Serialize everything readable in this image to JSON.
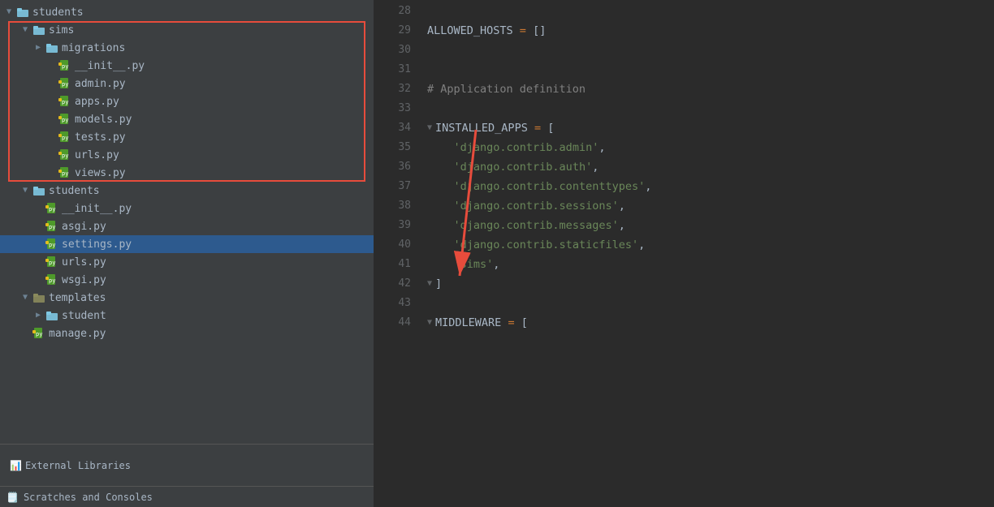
{
  "sidebar": {
    "items": [
      {
        "id": "students-root",
        "label": "students",
        "type": "folder",
        "indent": 0,
        "state": "open"
      },
      {
        "id": "sims-folder",
        "label": "sims",
        "type": "folder",
        "indent": 1,
        "state": "open",
        "redbox": true
      },
      {
        "id": "migrations-folder",
        "label": "migrations",
        "type": "folder",
        "indent": 2,
        "state": "closed"
      },
      {
        "id": "init-py-sims",
        "label": "__init__.py",
        "type": "file-py",
        "indent": 3
      },
      {
        "id": "admin-py",
        "label": "admin.py",
        "type": "file-py",
        "indent": 3
      },
      {
        "id": "apps-py",
        "label": "apps.py",
        "type": "file-py",
        "indent": 3
      },
      {
        "id": "models-py",
        "label": "models.py",
        "type": "file-py",
        "indent": 3
      },
      {
        "id": "tests-py",
        "label": "tests.py",
        "type": "file-py",
        "indent": 3
      },
      {
        "id": "urls-py-sims",
        "label": "urls.py",
        "type": "file-py",
        "indent": 3
      },
      {
        "id": "views-py",
        "label": "views.py",
        "type": "file-py",
        "indent": 3
      },
      {
        "id": "students-folder",
        "label": "students",
        "type": "folder",
        "indent": 1,
        "state": "open"
      },
      {
        "id": "init-py-students",
        "label": "__init__.py",
        "type": "file-py",
        "indent": 2
      },
      {
        "id": "asgi-py",
        "label": "asgi.py",
        "type": "file-py",
        "indent": 2
      },
      {
        "id": "settings-py",
        "label": "settings.py",
        "type": "file-py",
        "indent": 2,
        "selected": true
      },
      {
        "id": "urls-py-students",
        "label": "urls.py",
        "type": "file-py",
        "indent": 2
      },
      {
        "id": "wsgi-py",
        "label": "wsgi.py",
        "type": "file-py",
        "indent": 2
      },
      {
        "id": "templates-folder",
        "label": "templates",
        "type": "folder",
        "indent": 1,
        "state": "open"
      },
      {
        "id": "student-folder",
        "label": "student",
        "type": "folder",
        "indent": 2,
        "state": "closed"
      },
      {
        "id": "manage-py",
        "label": "manage.py",
        "type": "file-py",
        "indent": 1
      }
    ],
    "bottom": [
      {
        "id": "ext-libraries",
        "label": "External Libraries",
        "type": "folder-special"
      },
      {
        "id": "scratches",
        "label": "Scratches and Consoles",
        "type": "folder-special"
      }
    ]
  },
  "editor": {
    "lines": [
      {
        "num": 28,
        "content": "",
        "tokens": []
      },
      {
        "num": 29,
        "content": "ALLOWED_HOSTS = []",
        "tokens": [
          {
            "text": "ALLOWED_HOSTS",
            "cls": "var"
          },
          {
            "text": " = ",
            "cls": "kw"
          },
          {
            "text": "[]",
            "cls": "bracket"
          }
        ]
      },
      {
        "num": 30,
        "content": "",
        "tokens": []
      },
      {
        "num": 31,
        "content": "",
        "tokens": []
      },
      {
        "num": 32,
        "content": "# Application definition",
        "tokens": [
          {
            "text": "# Application definition",
            "cls": "comment"
          }
        ]
      },
      {
        "num": 33,
        "content": "",
        "tokens": []
      },
      {
        "num": 34,
        "content": "INSTALLED_APPS = [",
        "tokens": [
          {
            "text": "INSTALLED_APPS",
            "cls": "var"
          },
          {
            "text": " = ",
            "cls": "kw"
          },
          {
            "text": "[",
            "cls": "bracket"
          }
        ],
        "foldable": true
      },
      {
        "num": 35,
        "content": "    'django.contrib.admin',",
        "tokens": [
          {
            "text": "    ",
            "cls": "var"
          },
          {
            "text": "'django.contrib.admin'",
            "cls": "str"
          },
          {
            "text": ",",
            "cls": "var"
          }
        ]
      },
      {
        "num": 36,
        "content": "    'django.contrib.auth',",
        "tokens": [
          {
            "text": "    ",
            "cls": "var"
          },
          {
            "text": "'django.contrib.auth'",
            "cls": "str"
          },
          {
            "text": ",",
            "cls": "var"
          }
        ]
      },
      {
        "num": 37,
        "content": "    'django.contrib.contenttypes',",
        "tokens": [
          {
            "text": "    ",
            "cls": "var"
          },
          {
            "text": "'django.contrib.contenttypes'",
            "cls": "str"
          },
          {
            "text": ",",
            "cls": "var"
          }
        ]
      },
      {
        "num": 38,
        "content": "    'django.contrib.sessions',",
        "tokens": [
          {
            "text": "    ",
            "cls": "var"
          },
          {
            "text": "'django.contrib.sessions'",
            "cls": "str"
          },
          {
            "text": ",",
            "cls": "var"
          }
        ]
      },
      {
        "num": 39,
        "content": "    'django.contrib.messages',",
        "tokens": [
          {
            "text": "    ",
            "cls": "var"
          },
          {
            "text": "'django.contrib.messages'",
            "cls": "str"
          },
          {
            "text": ",",
            "cls": "var"
          }
        ]
      },
      {
        "num": 40,
        "content": "    'django.contrib.staticfiles',",
        "tokens": [
          {
            "text": "    ",
            "cls": "var"
          },
          {
            "text": "'django.contrib.staticfiles'",
            "cls": "str"
          },
          {
            "text": ",",
            "cls": "var"
          }
        ]
      },
      {
        "num": 41,
        "content": "    'sims',",
        "tokens": [
          {
            "text": "    ",
            "cls": "var"
          },
          {
            "text": "'sims'",
            "cls": "str"
          },
          {
            "text": ",",
            "cls": "var"
          }
        ]
      },
      {
        "num": 42,
        "content": "]",
        "tokens": [
          {
            "text": "]",
            "cls": "bracket"
          }
        ],
        "foldable": true
      },
      {
        "num": 43,
        "content": "",
        "tokens": []
      },
      {
        "num": 44,
        "content": "MIDDLEWARE = [",
        "tokens": [
          {
            "text": "MIDDLEWARE",
            "cls": "var"
          },
          {
            "text": " = ",
            "cls": "kw"
          },
          {
            "text": "[",
            "cls": "bracket"
          }
        ],
        "foldable": true
      }
    ]
  },
  "colors": {
    "selected_bg": "#2d5a8e",
    "sidebar_bg": "#3c3f41",
    "editor_bg": "#2b2b2b",
    "red_box": "#e74c3c"
  }
}
